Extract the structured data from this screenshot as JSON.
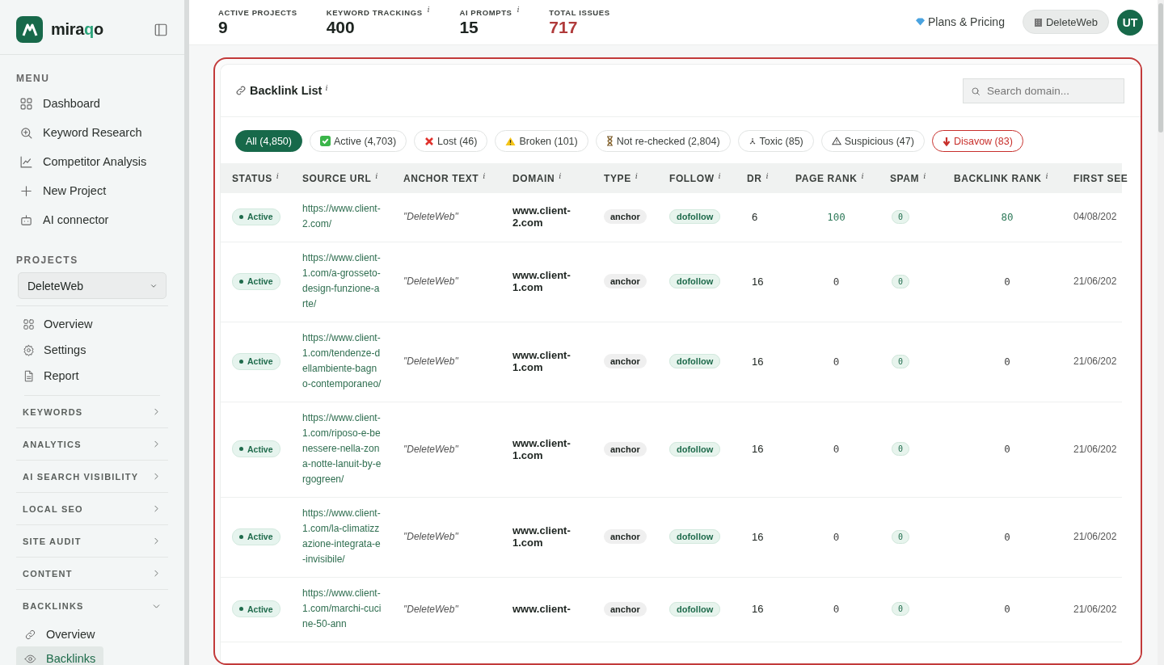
{
  "sidebar": {
    "brand": {
      "parts": [
        {
          "text": "mira",
          "accent": false
        },
        {
          "text": "q",
          "accent": true
        },
        {
          "text": "o",
          "accent": false
        }
      ]
    },
    "menu_title": "MENU",
    "menu": [
      {
        "label": "Dashboard"
      },
      {
        "label": "Keyword Research"
      },
      {
        "label": "Competitor Analysis"
      },
      {
        "label": "New Project"
      },
      {
        "label": "AI connector"
      }
    ],
    "projects_title": "PROJECTS",
    "project_select": {
      "value": "DeleteWeb"
    },
    "project_items": [
      {
        "label": "Overview"
      },
      {
        "label": "Settings"
      },
      {
        "label": "Report"
      }
    ],
    "sections": [
      {
        "label": "KEYWORDS",
        "expanded": false
      },
      {
        "label": "ANALYTICS",
        "expanded": false
      },
      {
        "label": "AI SEARCH VISIBILITY",
        "expanded": false
      },
      {
        "label": "LOCAL SEO",
        "expanded": false
      },
      {
        "label": "SITE AUDIT",
        "expanded": false
      },
      {
        "label": "CONTENT",
        "expanded": false
      },
      {
        "label": "BACKLINKS",
        "expanded": true,
        "children": [
          {
            "label": "Overview",
            "selected": false
          },
          {
            "label": "Backlinks",
            "selected": true
          }
        ]
      }
    ]
  },
  "topbar": {
    "stats": [
      {
        "label": "ACTIVE PROJECTS",
        "value": "9",
        "kind": "plain"
      },
      {
        "label": "KEYWORD TRACKINGS",
        "value": "400",
        "hint": "i",
        "kind": "plain"
      },
      {
        "label": "AI PROMPTS",
        "value": "15",
        "hint": "i",
        "kind": "plain"
      },
      {
        "label": "TOTAL ISSUES",
        "value": "717",
        "kind": "alert"
      }
    ],
    "plans_link": "Plans & Pricing",
    "workspace_button": "DeleteWeb",
    "avatar": "UT"
  },
  "panel": {
    "title": "Backlink List",
    "title_hint": "i",
    "search": {
      "placeholder": "Search domain..."
    },
    "filters": [
      {
        "label": "All (4,850)",
        "kind": "all",
        "selected": true
      },
      {
        "label": "Active (4,703)",
        "kind": "active",
        "selected": false
      },
      {
        "label": "Lost (46)",
        "kind": "lost",
        "selected": false
      },
      {
        "label": "Broken (101)",
        "kind": "broken",
        "selected": false
      },
      {
        "label": "Not re-checked (2,804)",
        "kind": "pending",
        "selected": false
      },
      {
        "label": "Toxic (85)",
        "kind": "toxic",
        "selected": false
      },
      {
        "label": "Suspicious (47)",
        "kind": "suspicious",
        "selected": false
      },
      {
        "label": "Disavow (83)",
        "kind": "disavow",
        "selected": false
      }
    ],
    "table": {
      "columns": [
        {
          "label": "STATUS",
          "hint": "i"
        },
        {
          "label": "SOURCE URL",
          "hint": "i"
        },
        {
          "label": "ANCHOR TEXT",
          "hint": "i"
        },
        {
          "label": "DOMAIN",
          "hint": "i"
        },
        {
          "label": "TYPE",
          "hint": "i"
        },
        {
          "label": "FOLLOW",
          "hint": "i"
        },
        {
          "label": "DR",
          "hint": "i"
        },
        {
          "label": "PAGE RANK",
          "hint": "i"
        },
        {
          "label": "SPAM",
          "hint": "i"
        },
        {
          "label": "BACKLINK RANK",
          "hint": "i"
        },
        {
          "label": "FIRST SEE"
        }
      ],
      "rows": [
        {
          "status": {
            "label": "Active",
            "kind": "active"
          },
          "source_url": "https://www.client-2.com/",
          "anchor_text": "\"DeleteWeb\"",
          "domain": "www.client-2.com",
          "type": "anchor",
          "follow": "dofollow",
          "dr": "6",
          "page_rank": "100",
          "spam": "0",
          "backlink_rank": "80",
          "first_seen": "04/08/202",
          "highlight": true
        },
        {
          "status": {
            "label": "Active",
            "kind": "active"
          },
          "source_url": "https://www.client-1.com/a-grosseto-design-funzione-arte/",
          "anchor_text": "\"DeleteWeb\"",
          "domain": "www.client-1.com",
          "type": "anchor",
          "follow": "dofollow",
          "dr": "16",
          "page_rank": "0",
          "spam": "0",
          "backlink_rank": "0",
          "first_seen": "21/06/202",
          "highlight": false
        },
        {
          "status": {
            "label": "Active",
            "kind": "active"
          },
          "source_url": "https://www.client-1.com/tendenze-dellambiente-bagno-contemporaneo/",
          "anchor_text": "\"DeleteWeb\"",
          "domain": "www.client-1.com",
          "type": "anchor",
          "follow": "dofollow",
          "dr": "16",
          "page_rank": "0",
          "spam": "0",
          "backlink_rank": "0",
          "first_seen": "21/06/202",
          "highlight": false
        },
        {
          "status": {
            "label": "Active",
            "kind": "active"
          },
          "source_url": "https://www.client-1.com/riposo-e-benessere-nella-zona-notte-lanuit-by-ergogreen/",
          "anchor_text": "\"DeleteWeb\"",
          "domain": "www.client-1.com",
          "type": "anchor",
          "follow": "dofollow",
          "dr": "16",
          "page_rank": "0",
          "spam": "0",
          "backlink_rank": "0",
          "first_seen": "21/06/202",
          "highlight": false
        },
        {
          "status": {
            "label": "Active",
            "kind": "active"
          },
          "source_url": "https://www.client-1.com/la-climatizzazione-integrata-e-invisibile/",
          "anchor_text": "\"DeleteWeb\"",
          "domain": "www.client-1.com",
          "type": "anchor",
          "follow": "dofollow",
          "dr": "16",
          "page_rank": "0",
          "spam": "0",
          "backlink_rank": "0",
          "first_seen": "21/06/202",
          "highlight": false
        },
        {
          "status": {
            "label": "Active",
            "kind": "active"
          },
          "source_url": "https://www.client-1.com/marchi-cucine-50-ann",
          "anchor_text": "\"DeleteWeb\"",
          "domain": "www.client-",
          "type": "anchor",
          "follow": "dofollow",
          "dr": "16",
          "page_rank": "0",
          "spam": "0",
          "backlink_rank": "0",
          "first_seen": "21/06/202",
          "highlight": false
        }
      ]
    }
  }
}
